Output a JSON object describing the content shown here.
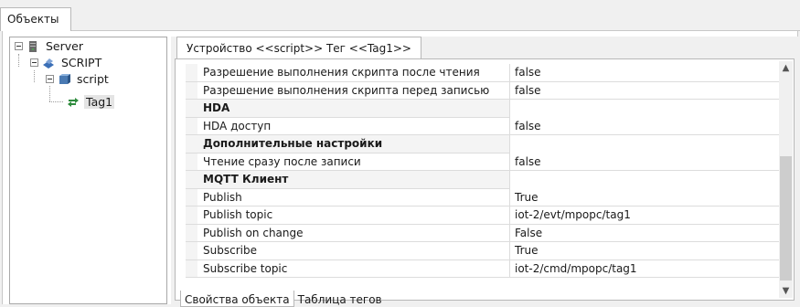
{
  "window": {
    "tab_label": "Объекты"
  },
  "tree": {
    "server": {
      "label": "Server",
      "icon": "server-icon"
    },
    "script_group": {
      "label": "SCRIPT",
      "icon": "device-icon"
    },
    "script_device": {
      "label": "script",
      "icon": "script-icon"
    },
    "tag": {
      "label": "Tag1",
      "icon": "tag-icon"
    }
  },
  "panel": {
    "tab_label": "Устройство <<script>> Тег  <<Tag1>>",
    "rows": [
      {
        "name": "Разрешение выполнения скрипта после чтения",
        "value": "false"
      },
      {
        "name": "Разрешение выполнения скрипта перед записью",
        "value": "false"
      },
      {
        "category": "HDA"
      },
      {
        "name": "HDA доступ",
        "value": "false"
      },
      {
        "category": "Дополнительные настройки"
      },
      {
        "name": "Чтение сразу после записи",
        "value": "false"
      },
      {
        "category": "MQTT Клиент"
      },
      {
        "name": "Publish",
        "value": "True"
      },
      {
        "name": "Publish topic",
        "value": "iot-2/evt/mpopc/tag1"
      },
      {
        "name": "Publish on change",
        "value": "False"
      },
      {
        "name": "Subscribe",
        "value": "True"
      },
      {
        "name": "Subscribe topic",
        "value": "iot-2/cmd/mpopc/tag1"
      }
    ],
    "scroll_up": "▲",
    "scroll_down": "▼"
  },
  "bottom_tabs": [
    {
      "label": "Свойства объекта",
      "active": true
    },
    {
      "label": "Таблица тегов",
      "active": false
    }
  ]
}
